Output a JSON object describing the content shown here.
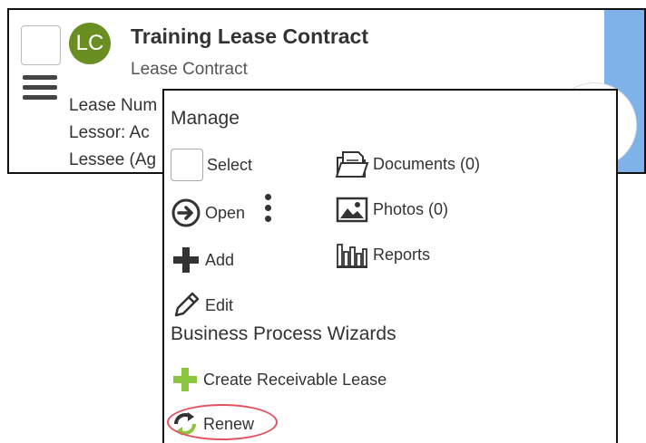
{
  "card": {
    "avatar_initials": "LC",
    "title": "Training Lease Contract",
    "subtitle": "Lease Contract",
    "line1": "Lease Num",
    "line2": "Lessor: Ac",
    "line3": "Lessee (Ag"
  },
  "menu": {
    "manage_heading": "Manage",
    "select_label": "Select",
    "open_label": "Open",
    "add_label": "Add",
    "edit_label": "Edit",
    "documents_label": "Documents (0)",
    "photos_label": "Photos (0)",
    "reports_label": "Reports",
    "wizards_heading": "Business Process Wizards",
    "create_receivable_label": "Create Receivable Lease",
    "renew_label": "Renew"
  },
  "colors": {
    "avatar": "#6b8e23",
    "accent_strip": "#7fb2e8",
    "plus_green": "#8cc63f",
    "highlight_ring": "#e05260"
  }
}
